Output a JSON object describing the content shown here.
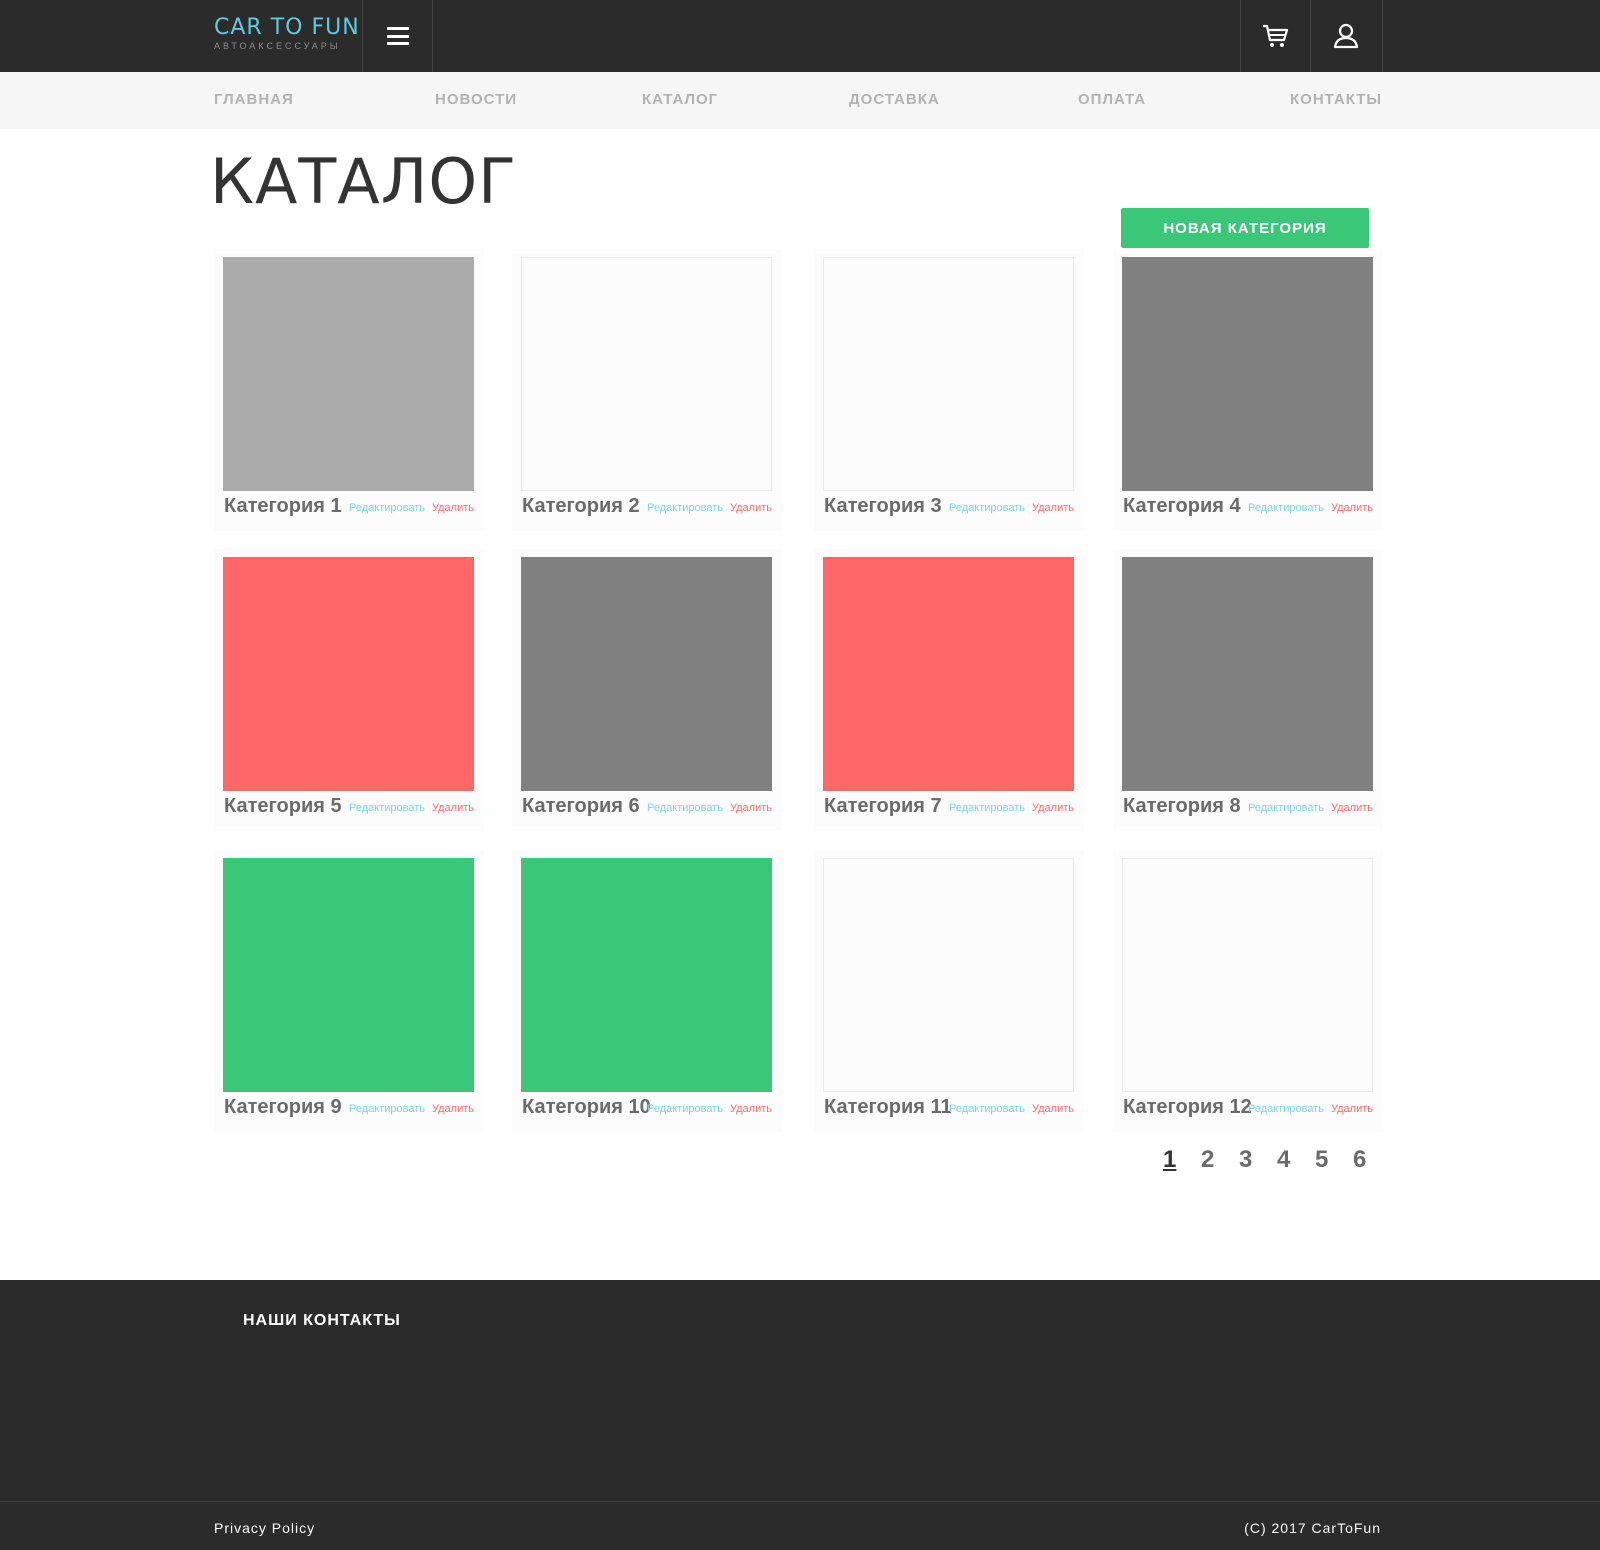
{
  "header": {
    "logo_title": "CAR TO FUN",
    "logo_subtitle": "АВТОАКСЕССУАРЫ",
    "menu_icon": "hamburger-icon",
    "cart_icon": "cart-icon",
    "user_icon": "user-icon"
  },
  "nav": {
    "items": [
      {
        "label": "ГЛАВНАЯ"
      },
      {
        "label": "НОВОСТИ"
      },
      {
        "label": "КАТАЛОГ"
      },
      {
        "label": "ДОСТАВКА"
      },
      {
        "label": "ОПЛАТА"
      },
      {
        "label": "КОНТАКТЫ"
      }
    ]
  },
  "main": {
    "title": "КАТАЛОГ",
    "new_category_label": "НОВАЯ КАТЕГОРИЯ",
    "edit_label": "Редактировать",
    "delete_label": "Удалить",
    "categories": [
      {
        "name": "Категория 1",
        "color": "#ababab"
      },
      {
        "name": "Категория 2",
        "color": "#fcfcfc"
      },
      {
        "name": "Категория 3",
        "color": "#fcfcfc"
      },
      {
        "name": "Категория 4",
        "color": "#808080"
      },
      {
        "name": "Категория 5",
        "color": "#ff6666"
      },
      {
        "name": "Категория 6",
        "color": "#808080"
      },
      {
        "name": "Категория 7",
        "color": "#ff6666"
      },
      {
        "name": "Категория 8",
        "color": "#808080"
      },
      {
        "name": "Категория 9",
        "color": "#3ac778"
      },
      {
        "name": "Категория 10",
        "color": "#3ac778"
      },
      {
        "name": "Категория 11",
        "color": "#fcfcfc"
      },
      {
        "name": "Категория 12",
        "color": "#fcfcfc"
      }
    ],
    "pagination": {
      "pages": [
        "1",
        "2",
        "3",
        "4",
        "5",
        "6"
      ],
      "current": "1"
    }
  },
  "footer": {
    "heading": "НАШИ КОНТАКТЫ",
    "privacy": "Privacy Policy",
    "copyright": "(C) 2017 CarToFun"
  },
  "colors": {
    "header_bg": "#2b2b2b",
    "nav_bg": "#f7f7f7",
    "accent_green": "#3ac778",
    "accent_blue": "#5ecbe0",
    "accent_red": "#ff6b6b"
  }
}
